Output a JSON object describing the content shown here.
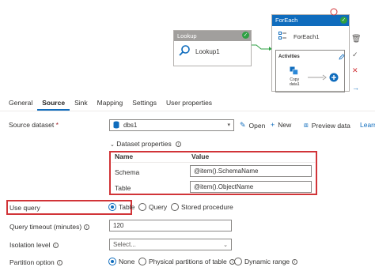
{
  "canvas": {
    "lookup": {
      "title": "Lookup",
      "name": "Lookup1"
    },
    "foreach": {
      "title": "ForEach",
      "name": "ForEach1",
      "activities_label": "Activities",
      "copy_label_1": "Copy",
      "copy_label_2": "data1"
    }
  },
  "tabs": [
    "General",
    "Source",
    "Sink",
    "Mapping",
    "Settings",
    "User properties"
  ],
  "active_tab": "Source",
  "source_dataset": {
    "label": "Source dataset",
    "required_mark": "*",
    "value": "dbs1",
    "actions": {
      "open": "Open",
      "new": "New",
      "preview": "Preview data",
      "learn": "Learn"
    }
  },
  "dataset_properties": {
    "toggle_label": "Dataset properties",
    "col_name": "Name",
    "col_value": "Value",
    "rows": [
      {
        "name": "Schema",
        "value": "@item().SchemaName"
      },
      {
        "name": "Table",
        "value": "@item().ObjectName"
      }
    ]
  },
  "use_query": {
    "label": "Use query",
    "options": [
      "Table",
      "Query",
      "Stored procedure"
    ],
    "selected": "Table"
  },
  "query_timeout": {
    "label": "Query timeout (minutes)",
    "value": "120"
  },
  "isolation_level": {
    "label": "Isolation level",
    "placeholder": "Select..."
  },
  "partition_option": {
    "label": "Partition option",
    "options": [
      "None",
      "Physical partitions of table",
      "Dynamic range"
    ],
    "selected": "None"
  },
  "colors": {
    "accent": "#0f6cbd",
    "highlight": "#d13438",
    "success": "#2ea043"
  }
}
